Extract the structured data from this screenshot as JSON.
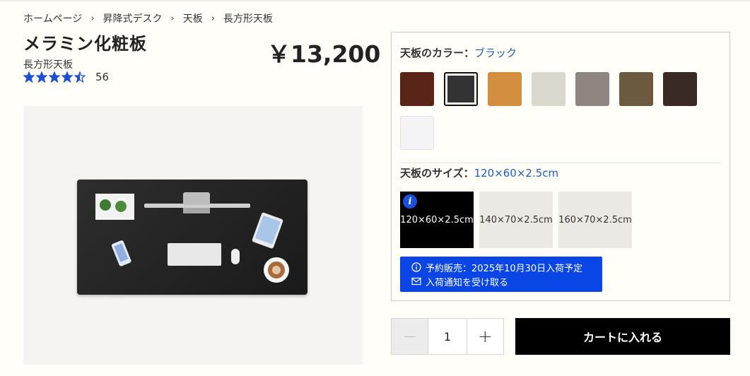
{
  "breadcrumb": [
    "ホームページ",
    "昇降式デスク",
    "天板",
    "長方形天板"
  ],
  "product": {
    "title": "メラミン化粧板",
    "subtitle": "長方形天板",
    "price": "￥13,200",
    "rating": {
      "value": 4.5,
      "max": 5,
      "count": "56"
    }
  },
  "colors": {
    "label": "天板のカラー：",
    "selected": "ブラック",
    "swatches": [
      "#5a2519",
      "#333333",
      "#d38f3f",
      "#dad7ce",
      "#8e8580",
      "#6b5a40",
      "#3a2a26",
      "#f4f4f6"
    ],
    "selected_index": 1
  },
  "size": {
    "label": "天板のサイズ：",
    "selected": "120×60×2.5cm",
    "options": [
      "120×60×2.5cm",
      "140×70×2.5cm",
      "160×70×2.5cm"
    ],
    "selected_index": 0,
    "info_icon": "i"
  },
  "preorder": {
    "line1": "予約販売：2025年10月30日入荷予定",
    "line2": "入荷通知を受け取る"
  },
  "quantity": {
    "value": "1",
    "plus": "+"
  },
  "cart": {
    "label": "カートに入れる"
  },
  "theme": {
    "accent": "#1d5cb8",
    "notice_bg": "#0a45e6",
    "star": "#1d4ed8"
  }
}
